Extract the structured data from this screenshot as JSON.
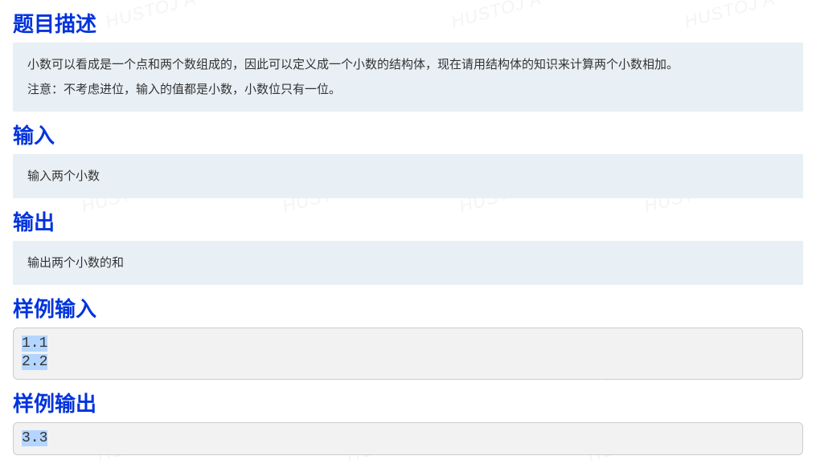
{
  "watermark_text": "HUSTOJ A",
  "sections": {
    "desc": {
      "heading": "题目描述",
      "para1": "小数可以看成是一个点和两个数组成的，因此可以定义成一个小数的结构体，现在请用结构体的知识来计算两个小数相加。",
      "para2": "注意：不考虑进位，输入的值都是小数，小数位只有一位。"
    },
    "input": {
      "heading": "输入",
      "text": "输入两个小数"
    },
    "output": {
      "heading": "输出",
      "text": "输出两个小数的和"
    },
    "sample_input": {
      "heading": "样例输入",
      "code": "1.1\n2.2"
    },
    "sample_output": {
      "heading": "样例输出",
      "code": "3.3"
    }
  }
}
